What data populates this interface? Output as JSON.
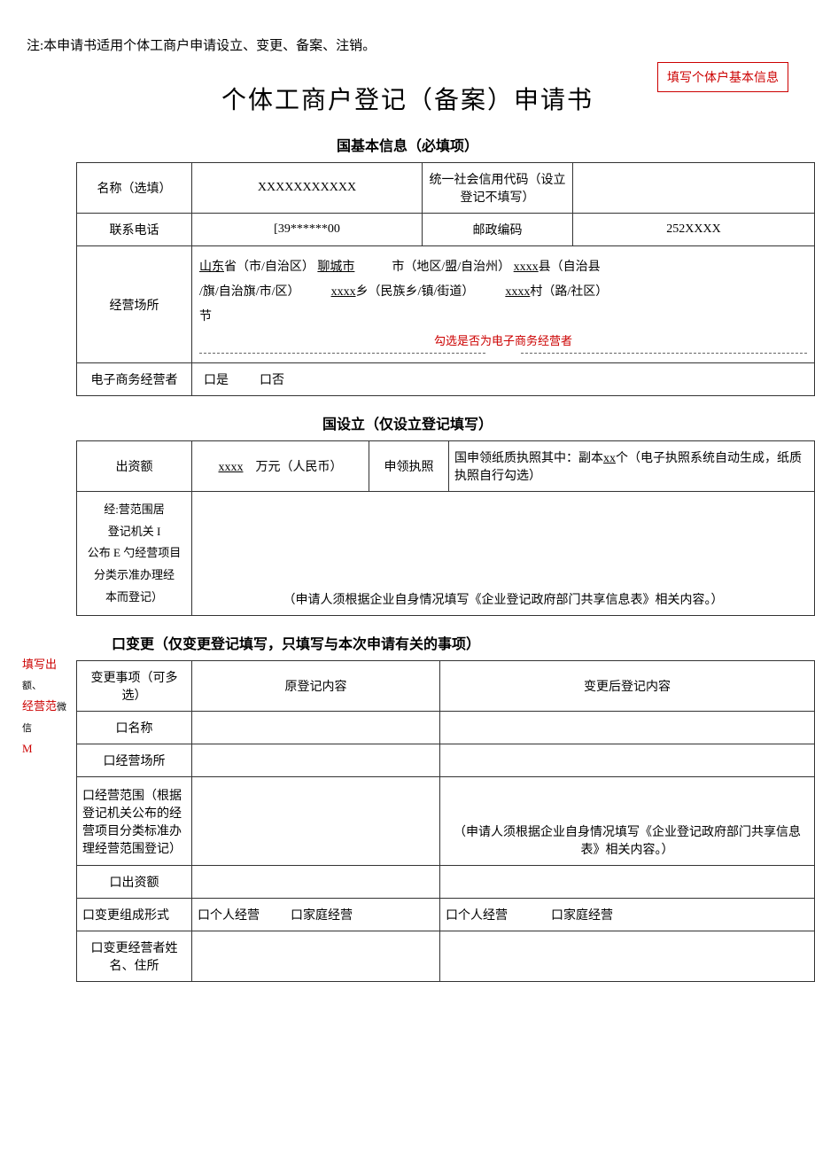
{
  "note": "注:本申请书适用个体工商户申请设立、变更、备案、注销。",
  "box_right": "填写个体户基本信息",
  "title": "个体工商户登记（备案）申请书",
  "sec1_title": "国基本信息（必填项）",
  "sec2_title": "国设立（仅设立登记填写）",
  "sec3_title": "口变更（仅变更登记填写，只填写与本次申请有关的事项）",
  "t1": {
    "r1c1": "名称（选填）",
    "r1c2": "XXXXXXXXXXX",
    "r1c3": "统一社会信用代码（设立登记不填写）",
    "r2c1": "联系电话",
    "r2c2": "[39******00",
    "r2c3": "邮政编码",
    "r2c4": "252XXXX",
    "r3c1": "经营场所",
    "loc_prov": "山东",
    "loc_prov_suf": "省（市/自治区）",
    "loc_city": "聊城市",
    "loc_city_suf": "市（地区/盟/自治州）",
    "loc_county": "xxxx",
    "loc_county_suf": "县（自治县",
    "loc_county_suf2": "/旗/自治旗/市/区）",
    "loc_town": "xxxx",
    "loc_town_suf": "乡（民族乡/镇/街道）",
    "loc_vil": "xxxx",
    "loc_vil_suf": "村（路/社区）",
    "loc_jie": "节",
    "red_note": "勾选是否为电子商务经营者",
    "r4c1": "电子商务经营者",
    "yes": "口是",
    "no": "口否"
  },
  "t2": {
    "r1c1": "出资额",
    "r1c2u": "xxxx",
    "r1c2t": "万元（人民币）",
    "r1c3": "申领执照",
    "r1c4a": "国申领纸质执照其中：副本",
    "r1c4u": "xx",
    "r1c4b": "个（电子执照系统自动生成，纸质执照自行勾选）",
    "r2c1a": "经:营范围居",
    "r2c1b": "登记机关 I",
    "r2c1c": "公布 E 勺经营项目",
    "r2c1d": "分类示准办理经",
    "r2c1e": "本而登记）",
    "r2c2": "（申请人须根据企业自身情况填写《企业登记政府部门共享信息表》相关内容。）"
  },
  "t3": {
    "h1": "变更事项（可多选）",
    "h2": "原登记内容",
    "h3": "变更后登记内容",
    "r1": "口名称",
    "r2": "口经营场所",
    "r3": "口经营范围（根据登记机关公布的经营项目分类标准办理经营范围登记）",
    "r3c3": "（申请人须根据企业自身情况填写《企业登记政府部门共享信息表》相关内容。）",
    "r4": "口出资额",
    "r5": "口变更组成形式",
    "r5opt1": "口个人经营",
    "r5opt2": "口家庭经营",
    "r6": "口变更经营者姓名、住所"
  },
  "sidenote": {
    "l1a": "填写出",
    "l1b": "额、",
    "l2a": "经营范",
    "l2b": "微信",
    "l3": "M"
  }
}
